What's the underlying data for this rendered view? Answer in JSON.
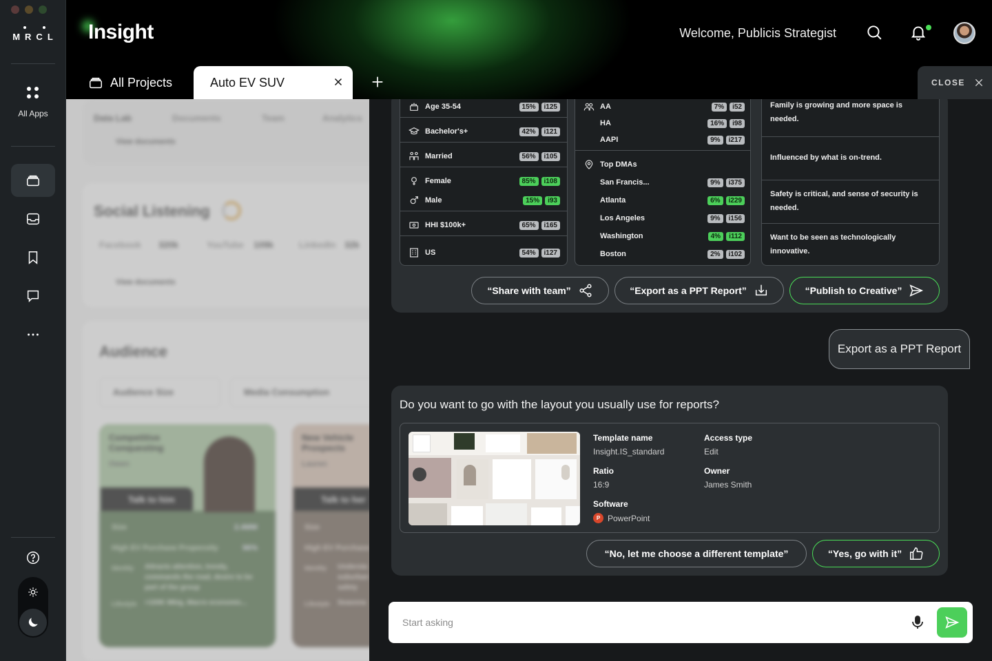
{
  "window_controls": {
    "colors": [
      "#5a3a3a",
      "#5a4a2a",
      "#2e4a2e"
    ]
  },
  "sidebar": {
    "logo": "MRCL",
    "all_apps_label": "All Apps",
    "nav_icons": [
      "projects-icon",
      "inbox-icon",
      "bookmark-icon",
      "chat-icon",
      "more-icon"
    ],
    "bottom_icons": [
      "help-icon",
      "sun-icon",
      "moon-icon"
    ]
  },
  "header": {
    "brand": "Insight",
    "welcome": "Welcome, Publicis Strategist",
    "accent": "#4ade57"
  },
  "tabs": {
    "all_projects": "All Projects",
    "active": "Auto EV SUV",
    "close_label": "CLOSE"
  },
  "background": {
    "subtabs": [
      "Data Lab",
      "Documents",
      "Team",
      "Analytics"
    ],
    "view_documents": "View documents",
    "social_title": "Social Listening",
    "social_stats": [
      {
        "label": "Facebook",
        "value": "320k"
      },
      {
        "label": "YouTube",
        "value": "109k"
      },
      {
        "label": "LinkedIn",
        "value": "32k"
      }
    ],
    "audience_title": "Audience",
    "filters": [
      "Audience Size",
      "Media Consumption"
    ],
    "card1": {
      "title": "Competitive Conquesting",
      "sub": "Owen",
      "talk": "Talk to him",
      "size_label": "Size",
      "size_value": "2.4MM",
      "prop_label": "High EV Purchase Propensity",
      "prop_value": "96%",
      "identity_label": "Identity",
      "identity_text": "Attracts attention, trendy, commands the road, desire to be part of the group",
      "lifestyle_label": "Lifestyle",
      "lifestyle_text": ">100K Mktg, Macro economic..."
    },
    "card2": {
      "title": "New Vehicle Prospects",
      "sub": "Lauren",
      "talk": "Talk to her",
      "size_label": "Size",
      "prop_label": "High EV Purchase",
      "identity_label": "Identity",
      "identity_text": "Understa suburban safety",
      "lifestyle_label": "Lifestyle",
      "lifestyle_text": "Seasona"
    }
  },
  "demographics_left": [
    {
      "label": "Age 35-54",
      "pct": "15%",
      "idx": "i125",
      "icon": "age-icon",
      "green": false
    },
    {
      "label": "Bachelor's+",
      "pct": "42%",
      "idx": "i121",
      "icon": "graduation-icon",
      "green": false
    },
    {
      "label": "Married",
      "pct": "56%",
      "idx": "i105",
      "icon": "family-icon",
      "green": false
    },
    {
      "label": "Female",
      "pct": "85%",
      "idx": "i108",
      "icon": "female-icon",
      "green": true
    },
    {
      "label": "Male",
      "pct": "15%",
      "idx": "i93",
      "icon": "male-icon",
      "green": true
    },
    {
      "label": "HHI $100k+",
      "pct": "65%",
      "idx": "i165",
      "icon": "money-icon",
      "green": false
    },
    {
      "label": "US",
      "pct": "54%",
      "idx": "i127",
      "icon": "building-icon",
      "green": false
    }
  ],
  "ethnicity": [
    {
      "label": "AA",
      "pct": "7%",
      "idx": "i52",
      "green": false
    },
    {
      "label": "HA",
      "pct": "16%",
      "idx": "i98",
      "green": false
    },
    {
      "label": "AAPI",
      "pct": "9%",
      "idx": "i217",
      "green": false
    }
  ],
  "dmas": {
    "title": "Top DMAs",
    "items": [
      {
        "label": "San Francis...",
        "pct": "9%",
        "idx": "i375",
        "green": false
      },
      {
        "label": "Atlanta",
        "pct": "6%",
        "idx": "i229",
        "green": true
      },
      {
        "label": "Los Angeles",
        "pct": "9%",
        "idx": "i156",
        "green": false
      },
      {
        "label": "Washington",
        "pct": "4%",
        "idx": "i112",
        "green": true
      },
      {
        "label": "Boston",
        "pct": "2%",
        "idx": "i102",
        "green": false
      }
    ]
  },
  "insights": [
    "Family is growing and more space is needed.",
    "Influenced by what is on-trend.",
    "Safety is critical, and sense of security is needed.",
    "Want to be seen as technologically innovative."
  ],
  "actions": {
    "share": "“Share with team”",
    "export": "“Export as a PPT Report”",
    "publish": "“Publish to Creative”"
  },
  "user_message": "Export as a PPT Report",
  "question": "Do you want to go with the layout you usually use for reports?",
  "template": {
    "name_label": "Template name",
    "name_value": "Insight.IS_standard",
    "access_label": "Access type",
    "access_value": "Edit",
    "ratio_label": "Ratio",
    "ratio_value": "16:9",
    "owner_label": "Owner",
    "owner_value": "James Smith",
    "software_label": "Software",
    "software_value": "PowerPoint"
  },
  "choices": {
    "no": "“No, let me choose a different template”",
    "yes": "“Yes, go with it”"
  },
  "input": {
    "placeholder": "Start asking"
  }
}
